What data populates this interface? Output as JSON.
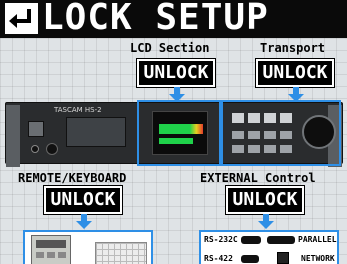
{
  "title": "LOCK SETUP",
  "sections": {
    "lcd": {
      "label": "LCD Section",
      "button": "UNLOCK"
    },
    "transport": {
      "label": "Transport",
      "button": "UNLOCK"
    },
    "remote": {
      "label": "REMOTE/KEYBOARD",
      "button": "UNLOCK"
    },
    "external": {
      "label": "EXTERNAL Control",
      "button": "UNLOCK"
    }
  },
  "device": {
    "brand": "TASCAM HS-2"
  },
  "external_ports": {
    "rs232c": "RS-232C",
    "parallel": "PARALLEL",
    "rs422": "RS-422",
    "network": "NETWORK"
  },
  "colors": {
    "accent": "#2e8fe6",
    "title_bar": "#0a0a0a",
    "button": "#000000"
  },
  "icons": {
    "back": "return-arrow-icon"
  }
}
